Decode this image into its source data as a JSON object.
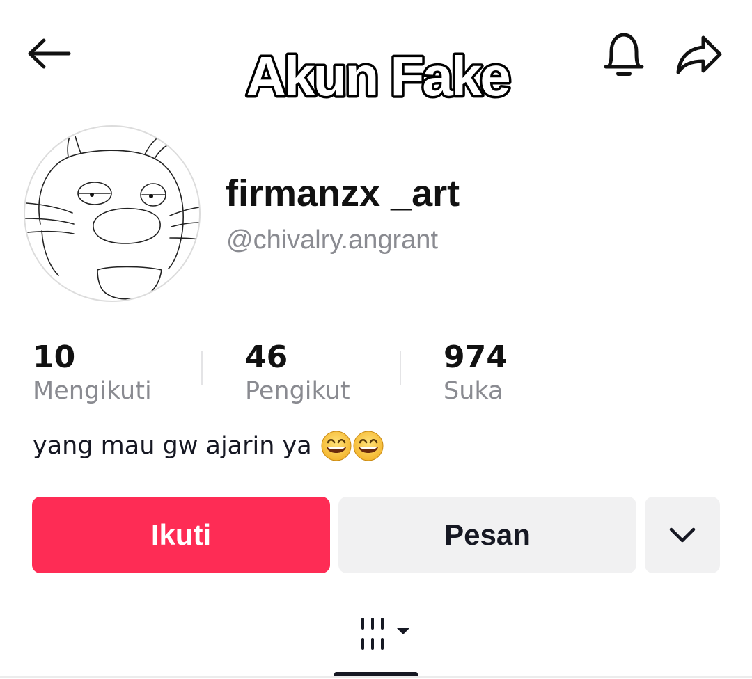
{
  "header": {
    "overlay_title": "Akun Fake",
    "back_icon": "arrow-left-icon",
    "bell_icon": "bell-icon",
    "share_icon": "share-icon"
  },
  "profile": {
    "display_name": "firmanzx _art",
    "username": "@chivalry.angrant",
    "avatar_icon": "cartoon-cat-avatar"
  },
  "stats": [
    {
      "value": "10",
      "label": "Mengikuti"
    },
    {
      "value": "46",
      "label": "Pengikut"
    },
    {
      "value": "974",
      "label": "Suka"
    }
  ],
  "bio": {
    "text": "yang mau gw ajarin ya",
    "emoji_icon": "grinning-face-emoji",
    "emoji_count": 2
  },
  "actions": {
    "follow_label": "Ikuti",
    "message_label": "Pesan",
    "more_icon": "chevron-down-icon",
    "follow_color": "#fe2c55",
    "secondary_color": "#f1f1f2"
  },
  "tabs": {
    "active_icon": "grid-videos-icon",
    "dropdown_icon": "caret-down-icon"
  }
}
